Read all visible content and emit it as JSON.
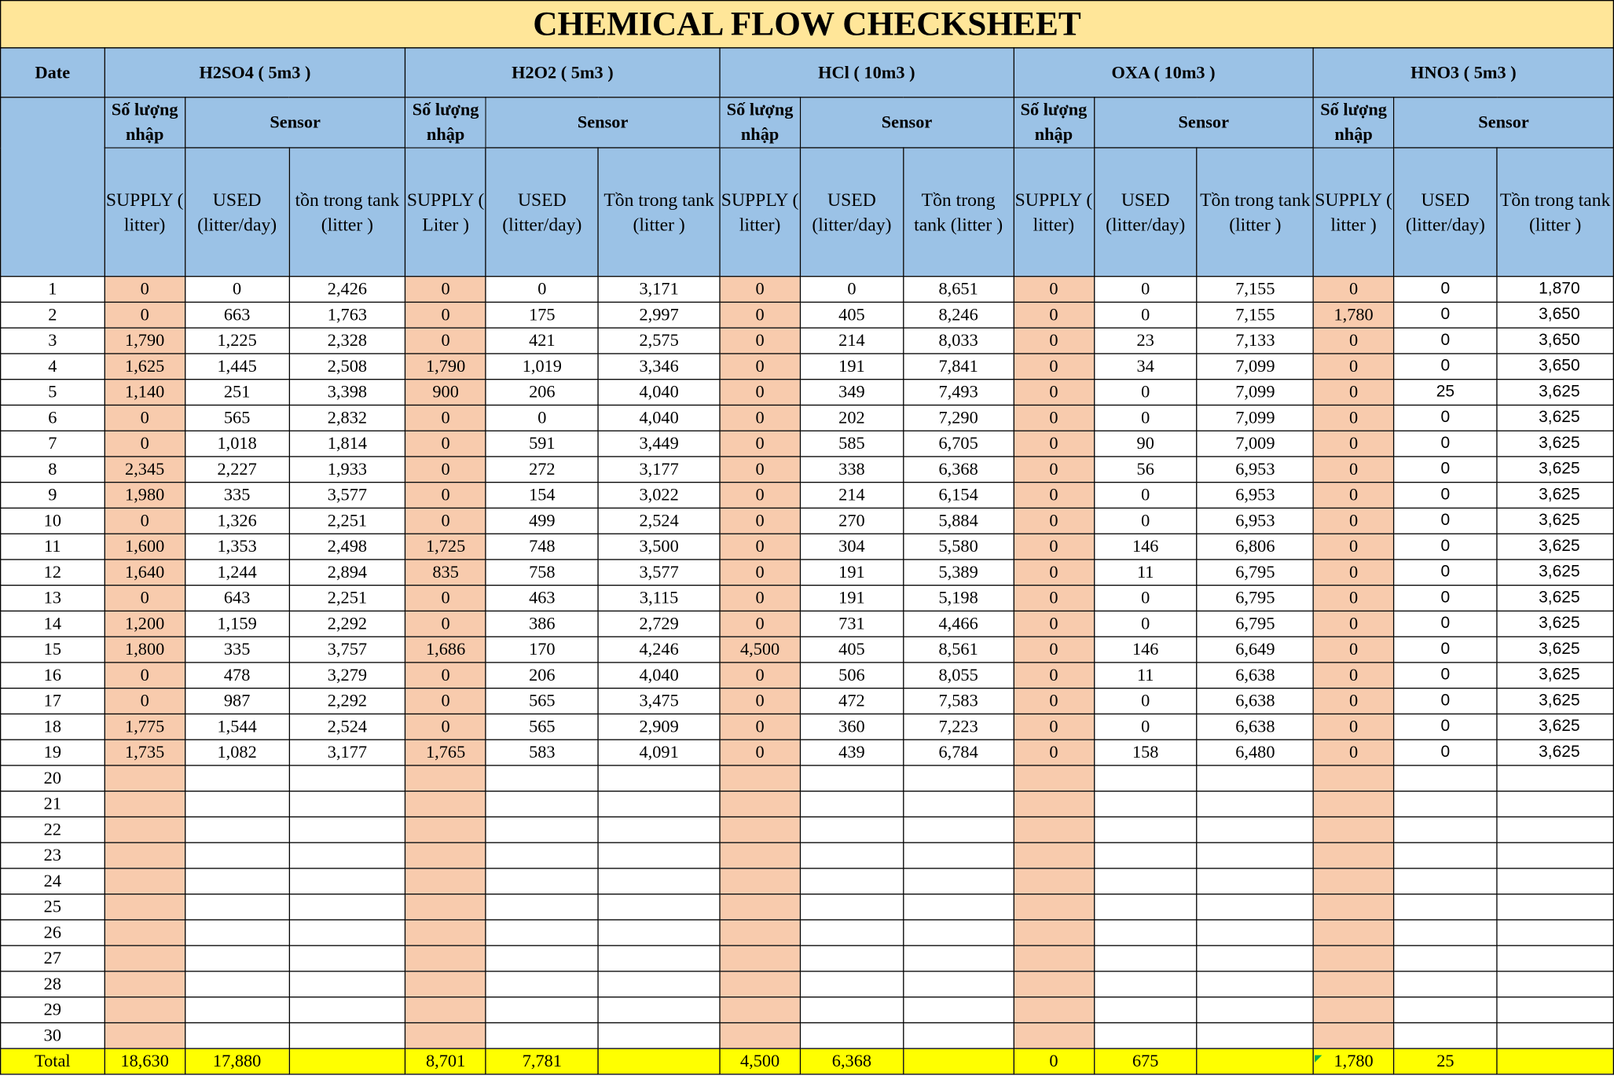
{
  "title": "CHEMICAL FLOW CHECKSHEET",
  "date_label": "Date",
  "total_label": "Total",
  "subheaders": {
    "qty": "Số lượng nhập",
    "sensor": "Sensor"
  },
  "groups": [
    {
      "name": "H2SO4 ( 5m3 )",
      "supply": "SUPPLY ( litter)",
      "used": "USED (litter/day)",
      "tank": "tồn trong tank (litter )"
    },
    {
      "name": "H2O2 ( 5m3 )",
      "supply": "SUPPLY ( Liter )",
      "used": "USED (litter/day)",
      "tank": "Tồn trong tank (litter )"
    },
    {
      "name": "HCl ( 10m3 )",
      "supply": "SUPPLY ( litter)",
      "used": "USED (litter/day)",
      "tank": "Tồn trong tank (litter )"
    },
    {
      "name": "OXA ( 10m3 )",
      "supply": "SUPPLY ( litter)",
      "used": "USED (litter/day)",
      "tank": "Tồn trong tank (litter )"
    },
    {
      "name": "HNO3 ( 5m3 )",
      "supply": "SUPPLY ( litter )",
      "used": "USED (litter/day)",
      "tank": "Tồn trong tank (litter )"
    }
  ],
  "rows": [
    [
      "1",
      "0",
      "0",
      "2,426",
      "0",
      "0",
      "3,171",
      "0",
      "0",
      "8,651",
      "0",
      "0",
      "7,155",
      "0",
      "0",
      "1,870"
    ],
    [
      "2",
      "0",
      "663",
      "1,763",
      "0",
      "175",
      "2,997",
      "0",
      "405",
      "8,246",
      "0",
      "0",
      "7,155",
      "1,780",
      "0",
      "3,650"
    ],
    [
      "3",
      "1,790",
      "1,225",
      "2,328",
      "0",
      "421",
      "2,575",
      "0",
      "214",
      "8,033",
      "0",
      "23",
      "7,133",
      "0",
      "0",
      "3,650"
    ],
    [
      "4",
      "1,625",
      "1,445",
      "2,508",
      "1,790",
      "1,019",
      "3,346",
      "0",
      "191",
      "7,841",
      "0",
      "34",
      "7,099",
      "0",
      "0",
      "3,650"
    ],
    [
      "5",
      "1,140",
      "251",
      "3,398",
      "900",
      "206",
      "4,040",
      "0",
      "349",
      "7,493",
      "0",
      "0",
      "7,099",
      "0",
      "25",
      "3,625"
    ],
    [
      "6",
      "0",
      "565",
      "2,832",
      "0",
      "0",
      "4,040",
      "0",
      "202",
      "7,290",
      "0",
      "0",
      "7,099",
      "0",
      "0",
      "3,625"
    ],
    [
      "7",
      "0",
      "1,018",
      "1,814",
      "0",
      "591",
      "3,449",
      "0",
      "585",
      "6,705",
      "0",
      "90",
      "7,009",
      "0",
      "0",
      "3,625"
    ],
    [
      "8",
      "2,345",
      "2,227",
      "1,933",
      "0",
      "272",
      "3,177",
      "0",
      "338",
      "6,368",
      "0",
      "56",
      "6,953",
      "0",
      "0",
      "3,625"
    ],
    [
      "9",
      "1,980",
      "335",
      "3,577",
      "0",
      "154",
      "3,022",
      "0",
      "214",
      "6,154",
      "0",
      "0",
      "6,953",
      "0",
      "0",
      "3,625"
    ],
    [
      "10",
      "0",
      "1,326",
      "2,251",
      "0",
      "499",
      "2,524",
      "0",
      "270",
      "5,884",
      "0",
      "0",
      "6,953",
      "0",
      "0",
      "3,625"
    ],
    [
      "11",
      "1,600",
      "1,353",
      "2,498",
      "1,725",
      "748",
      "3,500",
      "0",
      "304",
      "5,580",
      "0",
      "146",
      "6,806",
      "0",
      "0",
      "3,625"
    ],
    [
      "12",
      "1,640",
      "1,244",
      "2,894",
      "835",
      "758",
      "3,577",
      "0",
      "191",
      "5,389",
      "0",
      "11",
      "6,795",
      "0",
      "0",
      "3,625"
    ],
    [
      "13",
      "0",
      "643",
      "2,251",
      "0",
      "463",
      "3,115",
      "0",
      "191",
      "5,198",
      "0",
      "0",
      "6,795",
      "0",
      "0",
      "3,625"
    ],
    [
      "14",
      "1,200",
      "1,159",
      "2,292",
      "0",
      "386",
      "2,729",
      "0",
      "731",
      "4,466",
      "0",
      "0",
      "6,795",
      "0",
      "0",
      "3,625"
    ],
    [
      "15",
      "1,800",
      "335",
      "3,757",
      "1,686",
      "170",
      "4,246",
      "4,500",
      "405",
      "8,561",
      "0",
      "146",
      "6,649",
      "0",
      "0",
      "3,625"
    ],
    [
      "16",
      "0",
      "478",
      "3,279",
      "0",
      "206",
      "4,040",
      "0",
      "506",
      "8,055",
      "0",
      "11",
      "6,638",
      "0",
      "0",
      "3,625"
    ],
    [
      "17",
      "0",
      "987",
      "2,292",
      "0",
      "565",
      "3,475",
      "0",
      "472",
      "7,583",
      "0",
      "0",
      "6,638",
      "0",
      "0",
      "3,625"
    ],
    [
      "18",
      "1,775",
      "1,544",
      "2,524",
      "0",
      "565",
      "2,909",
      "0",
      "360",
      "7,223",
      "0",
      "0",
      "6,638",
      "0",
      "0",
      "3,625"
    ],
    [
      "19",
      "1,735",
      "1,082",
      "3,177",
      "1,765",
      "583",
      "4,091",
      "0",
      "439",
      "6,784",
      "0",
      "158",
      "6,480",
      "0",
      "0",
      "3,625"
    ],
    [
      "20",
      "",
      "",
      "",
      "",
      "",
      "",
      "",
      "",
      "",
      "",
      "",
      "",
      "",
      "",
      ""
    ],
    [
      "21",
      "",
      "",
      "",
      "",
      "",
      "",
      "",
      "",
      "",
      "",
      "",
      "",
      "",
      "",
      ""
    ],
    [
      "22",
      "",
      "",
      "",
      "",
      "",
      "",
      "",
      "",
      "",
      "",
      "",
      "",
      "",
      "",
      ""
    ],
    [
      "23",
      "",
      "",
      "",
      "",
      "",
      "",
      "",
      "",
      "",
      "",
      "",
      "",
      "",
      "",
      ""
    ],
    [
      "24",
      "",
      "",
      "",
      "",
      "",
      "",
      "",
      "",
      "",
      "",
      "",
      "",
      "",
      "",
      ""
    ],
    [
      "25",
      "",
      "",
      "",
      "",
      "",
      "",
      "",
      "",
      "",
      "",
      "",
      "",
      "",
      "",
      ""
    ],
    [
      "26",
      "",
      "",
      "",
      "",
      "",
      "",
      "",
      "",
      "",
      "",
      "",
      "",
      "",
      "",
      ""
    ],
    [
      "27",
      "",
      "",
      "",
      "",
      "",
      "",
      "",
      "",
      "",
      "",
      "",
      "",
      "",
      "",
      ""
    ],
    [
      "28",
      "",
      "",
      "",
      "",
      "",
      "",
      "",
      "",
      "",
      "",
      "",
      "",
      "",
      "",
      ""
    ],
    [
      "29",
      "",
      "",
      "",
      "",
      "",
      "",
      "",
      "",
      "",
      "",
      "",
      "",
      "",
      "",
      ""
    ],
    [
      "30",
      "",
      "",
      "",
      "",
      "",
      "",
      "",
      "",
      "",
      "",
      "",
      "",
      "",
      "",
      ""
    ]
  ],
  "totals": [
    "18,630",
    "17,880",
    "",
    "8,701",
    "7,781",
    "",
    "4,500",
    "6,368",
    "",
    "0",
    "675",
    "",
    "1,780",
    "25",
    ""
  ]
}
